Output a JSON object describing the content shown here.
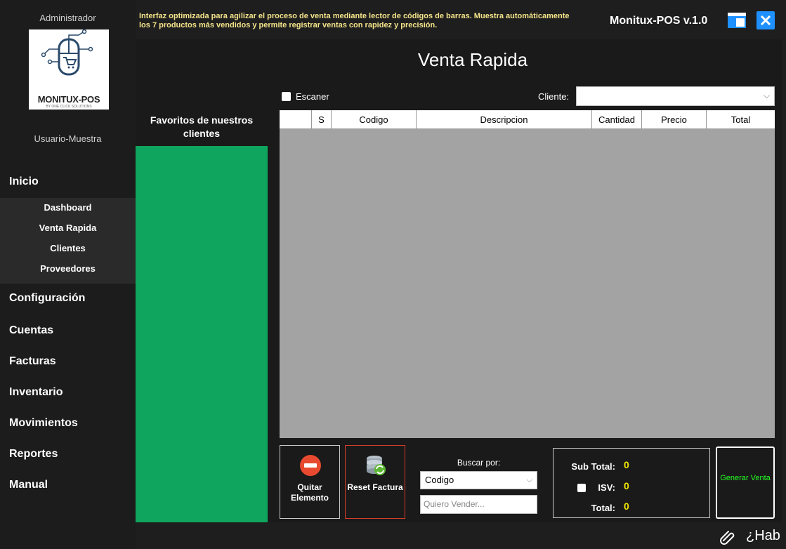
{
  "header": {
    "description": "Interfaz optimizada para agilizar el proceso de venta mediante lector de códigos de barras. Muestra automáticamente los 7 productos más vendidos y permite registrar ventas con rapidez y precisión.",
    "app_title": "Monitux-POS v.1.0"
  },
  "sidebar": {
    "role": "Administrador",
    "logo_text": "MONITUX-POS",
    "logo_sub": "BY ONE CLICK SOLUTIONS",
    "user": "Usuario-Muestra",
    "inicio": "Inicio",
    "subitems": [
      "Dashboard",
      "Venta Rapida",
      "Clientes",
      "Proveedores"
    ],
    "items": [
      "Configuración",
      "Cuentas",
      "Facturas",
      "Inventario",
      "Movimientos",
      "Reportes",
      "Manual"
    ]
  },
  "page": {
    "title": "Venta Rapida",
    "favorites_title": "Favoritos de nuestros clientes",
    "scanner_label": "Escaner",
    "client_label": "Cliente:",
    "client_value": ""
  },
  "grid": {
    "columns": [
      "",
      "S",
      "Codigo",
      "Descripcion",
      "Cantidad",
      "Precio",
      "Total"
    ]
  },
  "actions": {
    "remove_label": "Quitar Elemento",
    "reset_label": "Reset Factura",
    "search_by_label": "Buscar por:",
    "search_by_value": "Codigo",
    "search_placeholder": "Quiero Vender...",
    "generate_label": "Generar Venta"
  },
  "totals": {
    "subtotal_label": "Sub Total:",
    "subtotal_value": "0",
    "isv_label": "ISV:",
    "isv_value": "0",
    "total_label": "Total:",
    "total_value": "0"
  },
  "footer": {
    "text": "¿Hab"
  },
  "colors": {
    "accent_green": "#0fa55e",
    "header_text": "#f4e48a",
    "total_yellow": "#f2e700",
    "generate_text": "#22ff22",
    "reset_border": "#d43d2a",
    "close_button": "#1e90ff"
  }
}
